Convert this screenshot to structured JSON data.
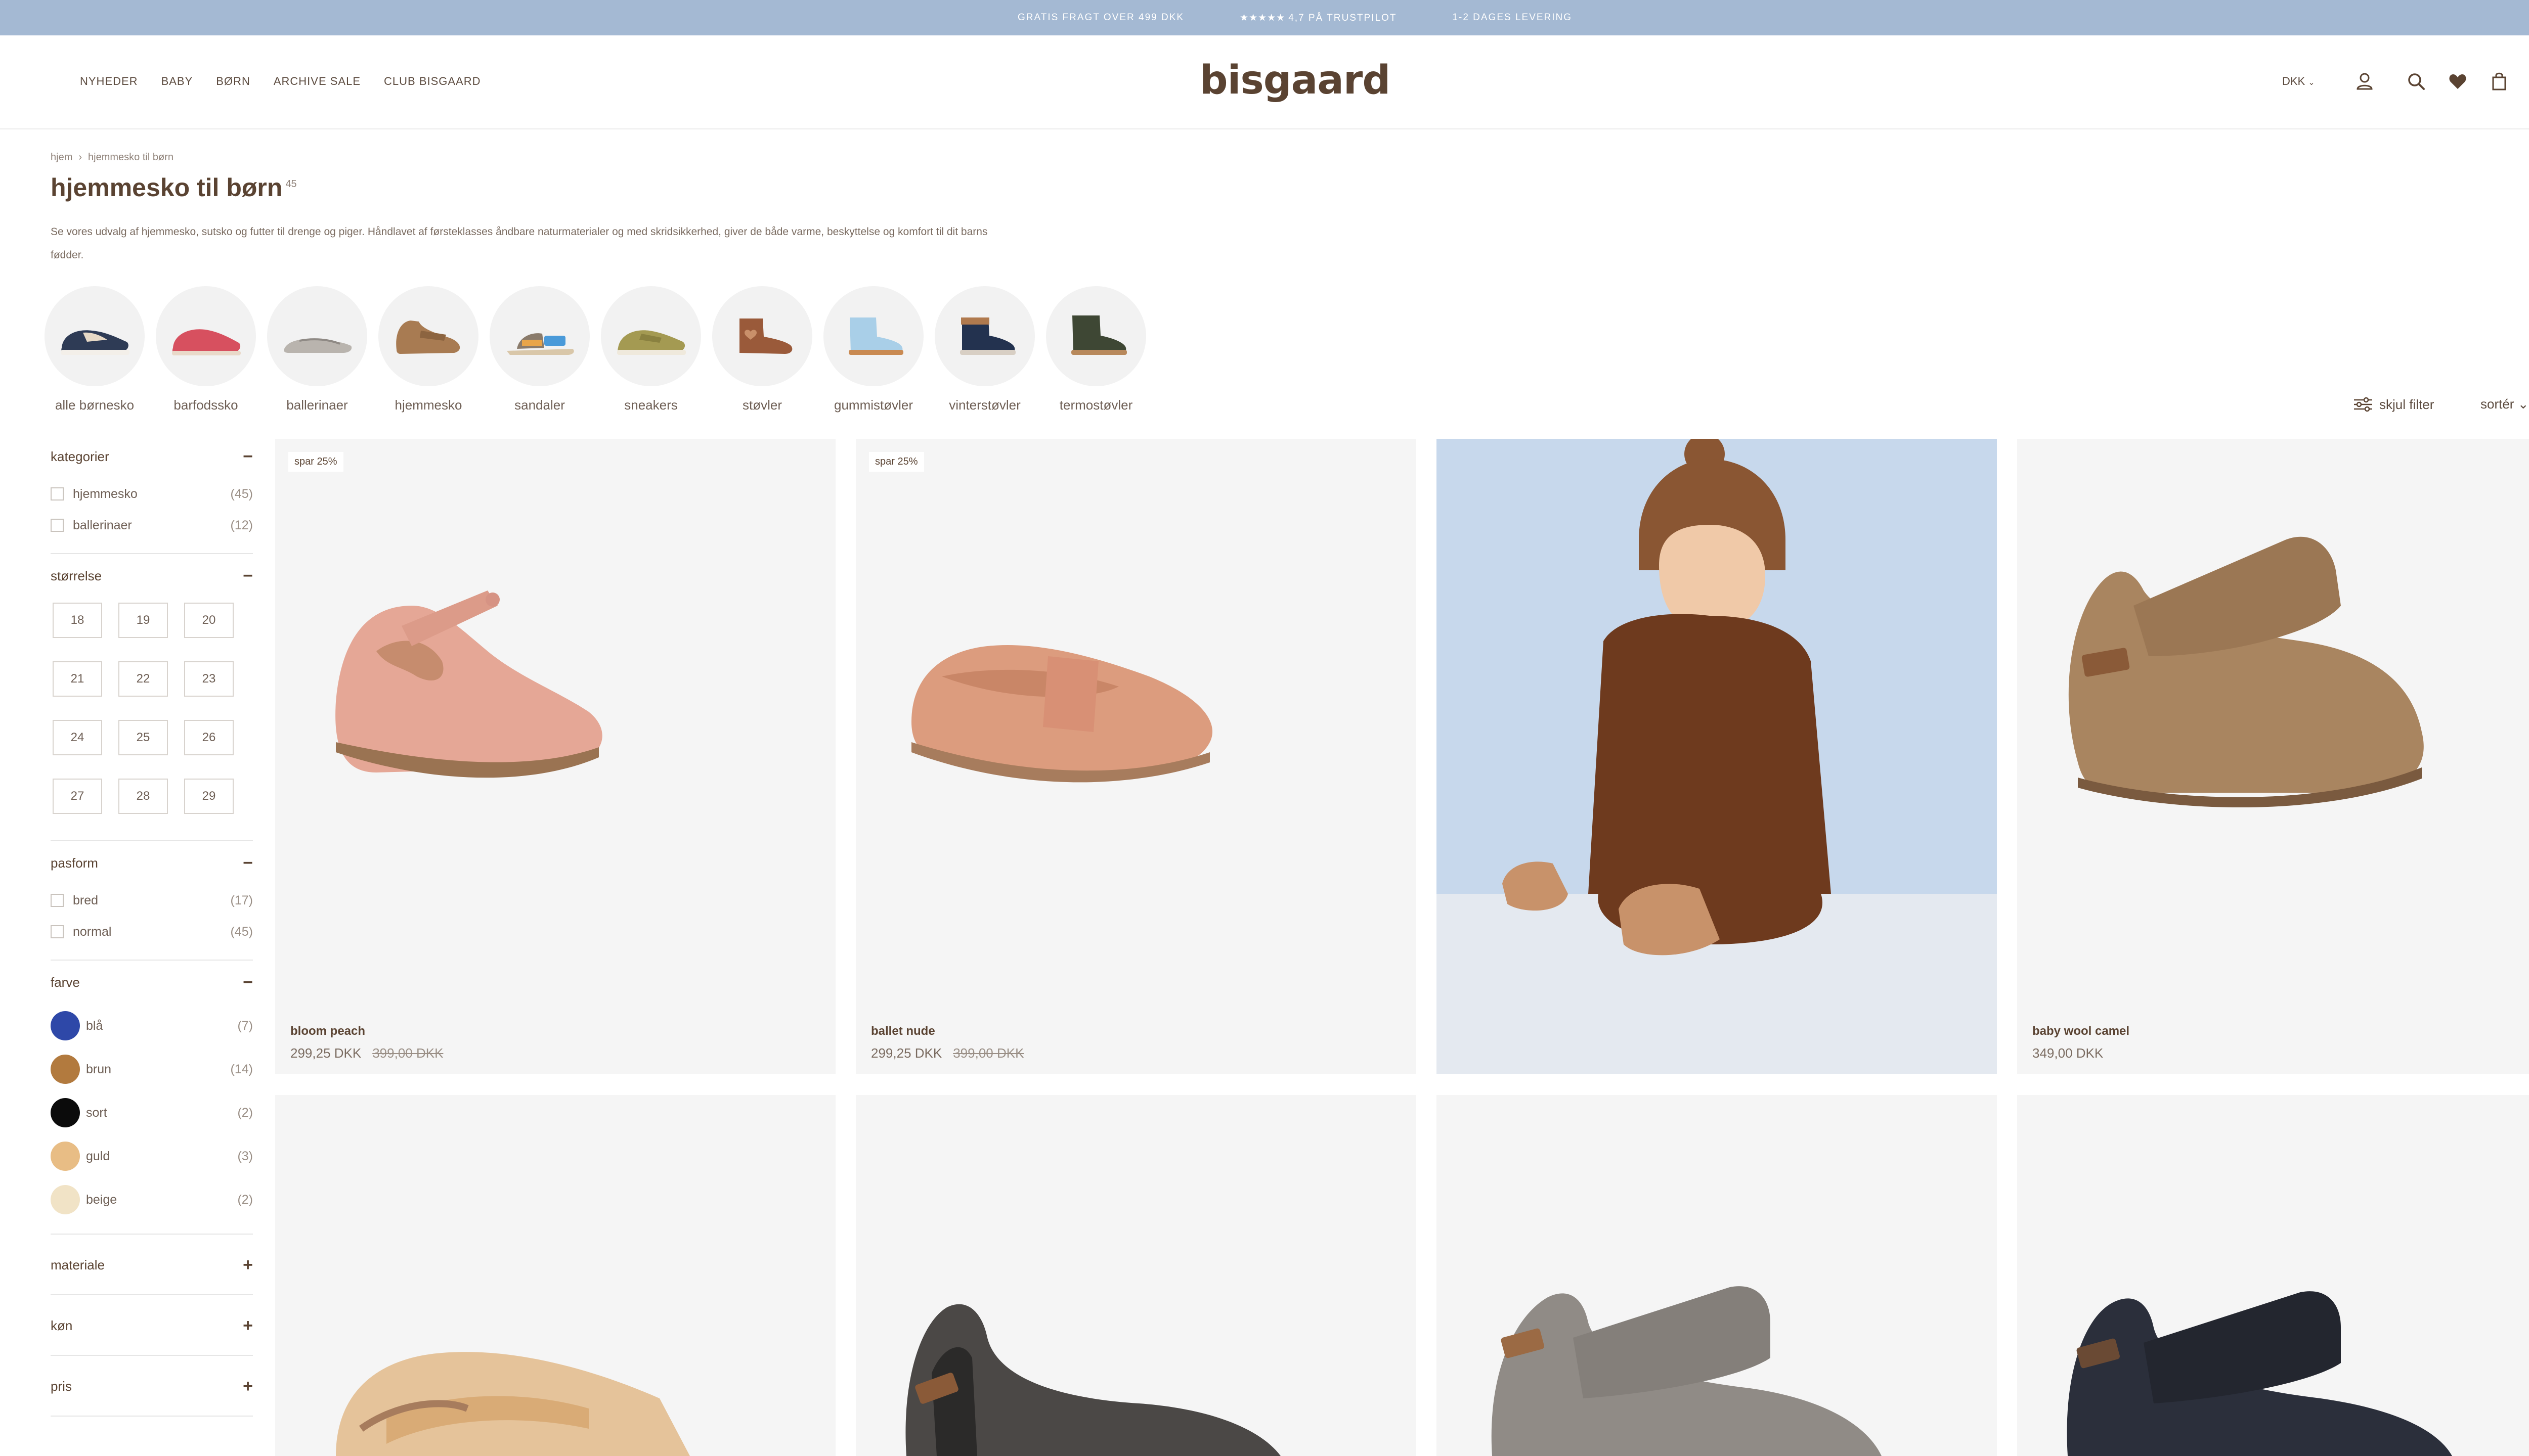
{
  "topbar": {
    "msg1": "GRATIS FRAGT OVER 499 DKK",
    "stars": "★★★★★",
    "msg2": "4,7 PÅ TRUSTPILOT",
    "msg3": "1-2 DAGES LEVERING"
  },
  "nav": {
    "items": [
      "NYHEDER",
      "BABY",
      "BØRN",
      "ARCHIVE SALE",
      "CLUB BISGAARD"
    ],
    "logo": "bisgaard",
    "currency": "DKK"
  },
  "page": {
    "breadcrumb": [
      "hjem",
      "hjemmesko til børn"
    ],
    "title": "hjemmesko til børn",
    "count": "45",
    "description": "Se vores udvalg af hjemmesko, sutsko og futter til drenge og piger. Håndlavet af førsteklasses åndbare naturmaterialer og med skridsikkerhed, giver de både varme, beskyttelse og komfort til dit barns fødder."
  },
  "categories": [
    "alle børnesko",
    "barfodssko",
    "ballerinaer",
    "hjemmesko",
    "sandaler",
    "sneakers",
    "støvler",
    "gummistøvler",
    "vinterstøvler",
    "termostøvler"
  ],
  "toolbar": {
    "filter_label": "skjul filter",
    "sort_label": "sortér"
  },
  "filters": {
    "kategorier": {
      "title": "kategorier",
      "toggle": "−",
      "items": [
        {
          "label": "hjemmesko",
          "count": "(45)"
        },
        {
          "label": "ballerinaer",
          "count": "(12)"
        }
      ]
    },
    "storrelse": {
      "title": "størrelse",
      "toggle": "−",
      "sizes": [
        "18",
        "19",
        "20",
        "21",
        "22",
        "23",
        "24",
        "25",
        "26",
        "27",
        "28",
        "29"
      ]
    },
    "pasform": {
      "title": "pasform",
      "toggle": "−",
      "items": [
        {
          "label": "bred",
          "count": "(17)"
        },
        {
          "label": "normal",
          "count": "(45)"
        }
      ]
    },
    "farve": {
      "title": "farve",
      "toggle": "−",
      "items": [
        {
          "label": "blå",
          "count": "(7)",
          "color": "#2e48a8"
        },
        {
          "label": "brun",
          "count": "(14)",
          "color": "#b27a3e"
        },
        {
          "label": "sort",
          "count": "(2)",
          "color": "#0b0b0b"
        },
        {
          "label": "guld",
          "count": "(3)",
          "color": "#e8bd85"
        },
        {
          "label": "beige",
          "count": "(2)",
          "color": "#f1e3c6"
        }
      ]
    },
    "materiale": {
      "title": "materiale",
      "toggle": "+"
    },
    "kon": {
      "title": "køn",
      "toggle": "+"
    },
    "pris": {
      "title": "pris",
      "toggle": "+"
    }
  },
  "products": [
    {
      "badge": "spar 25%",
      "name": "bloom peach",
      "price": "299,25 DKK",
      "old_price": "399,00 DKK"
    },
    {
      "badge": "spar 25%",
      "name": "ballet nude",
      "price": "299,25 DKK",
      "old_price": "399,00 DKK"
    },
    {
      "name": ""
    },
    {
      "name": "baby wool camel",
      "price": "349,00 DKK"
    }
  ],
  "colors": {
    "accent": "#5a4332",
    "topbar": "#a4b9d3",
    "card_bg": "#f5f5f5"
  }
}
